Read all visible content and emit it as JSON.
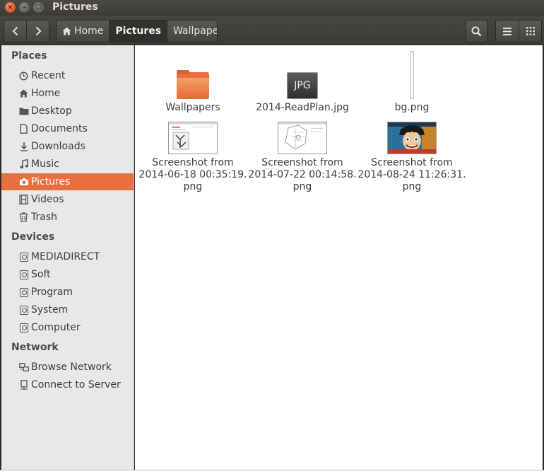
{
  "window": {
    "title": "Pictures",
    "close_glyph": "×",
    "min_glyph": "–",
    "max_glyph": "□"
  },
  "toolbar": {
    "back_icon": "chevron-left-icon",
    "forward_icon": "chevron-right-icon",
    "breadcrumbs": [
      {
        "label": "Home",
        "icon": "home-icon"
      },
      {
        "label": "Pictures",
        "active": true
      },
      {
        "label": "Wallpapers"
      }
    ],
    "search_icon": "search-icon",
    "list_view_icon": "list-view-icon",
    "grid_view_icon": "grid-view-icon"
  },
  "sidebar": {
    "places_title": "Places",
    "places": [
      {
        "label": "Recent",
        "icon": "clock-icon"
      },
      {
        "label": "Home",
        "icon": "home-icon"
      },
      {
        "label": "Desktop",
        "icon": "folder-icon"
      },
      {
        "label": "Documents",
        "icon": "document-icon"
      },
      {
        "label": "Downloads",
        "icon": "download-icon"
      },
      {
        "label": "Music",
        "icon": "music-icon"
      },
      {
        "label": "Pictures",
        "icon": "camera-icon",
        "selected": true
      },
      {
        "label": "Videos",
        "icon": "film-icon"
      },
      {
        "label": "Trash",
        "icon": "trash-icon"
      }
    ],
    "devices_title": "Devices",
    "devices": [
      {
        "label": "MEDIADIRECT",
        "icon": "drive-icon"
      },
      {
        "label": "Soft",
        "icon": "drive-icon"
      },
      {
        "label": "Program",
        "icon": "drive-icon"
      },
      {
        "label": "System",
        "icon": "drive-icon"
      },
      {
        "label": "Computer",
        "icon": "drive-icon"
      }
    ],
    "network_title": "Network",
    "network": [
      {
        "label": "Browse Network",
        "icon": "network-icon"
      },
      {
        "label": "Connect to Server",
        "icon": "server-icon"
      }
    ]
  },
  "files": [
    {
      "name": "Wallpapers",
      "kind": "folder"
    },
    {
      "name": "2014-ReadPlan.jpg",
      "kind": "jpg",
      "badge": "JPG"
    },
    {
      "name": "bg.png",
      "kind": "thin-image"
    },
    {
      "name_lines": [
        "Screenshot from",
        "2014-06-18 00:35:19.",
        "png"
      ],
      "kind": "screenshot"
    },
    {
      "name_lines": [
        "Screenshot from",
        "2014-07-22 00:14:58.",
        "png"
      ],
      "kind": "screenshot"
    },
    {
      "name_lines": [
        "Screenshot from",
        "2014-08-24 11:26:31.",
        "png"
      ],
      "kind": "screenshot"
    }
  ],
  "colors": {
    "accent": "#e8703e",
    "titlebar": "#3c3b37",
    "sidebar": "#e9e8e6"
  }
}
